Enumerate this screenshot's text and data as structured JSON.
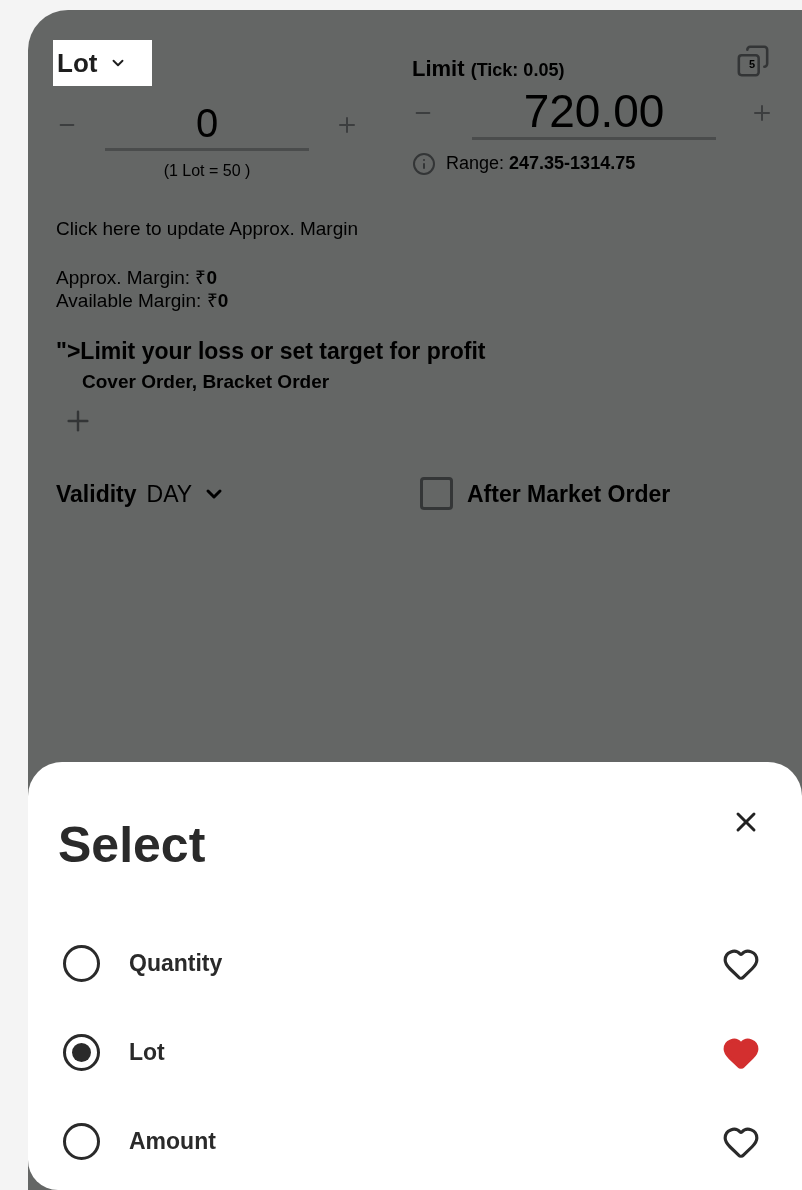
{
  "unit_selector": {
    "label": "Lot"
  },
  "quantity": {
    "value": "0",
    "note": "(1 Lot = 50 )"
  },
  "limit": {
    "label": "Limit",
    "tick": "(Tick: 0.05)",
    "value": "720.00",
    "range_label": "Range:",
    "range_value": "247.35-1314.75",
    "badge": "5"
  },
  "margin_link": "Click here to update Approx. Margin",
  "margins": [
    "Approx. Margin: ₹**0**",
    "Available Margin: ₹**0**"
  ],
  "advanced": {
    "title": "\">Limit your loss or set target for profit",
    "subtitle": "Cover Order, Bracket Order"
  },
  "validity": {
    "label": "Validity",
    "value": "DAY"
  },
  "after_market": {
    "label": "After Market Order",
    "checked": false
  },
  "sheet": {
    "title": "Select",
    "options": [
      {
        "label": "Quantity",
        "selected": false,
        "favorite": false
      },
      {
        "label": "Lot",
        "selected": true,
        "favorite": true
      },
      {
        "label": "Amount",
        "selected": false,
        "favorite": false
      }
    ]
  }
}
